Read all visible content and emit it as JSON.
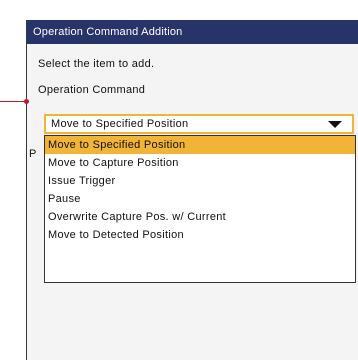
{
  "dialog": {
    "title": "Operation Command Addition",
    "prompt": "Select the item to add.",
    "command_label": "Operation Command",
    "param_label_fragment": "P"
  },
  "command_select": {
    "value": "Move to Specified Position",
    "options": [
      "Move to Specified Position",
      "Move to Capture Position",
      "Issue Trigger",
      "Pause",
      "Overwrite Capture Pos. w/ Current",
      "Move to Detected Position"
    ],
    "highlighted_index": 0
  },
  "colors": {
    "titlebar": "#27346a",
    "accent": "#f2b436",
    "leader_line": "#c0182b"
  }
}
